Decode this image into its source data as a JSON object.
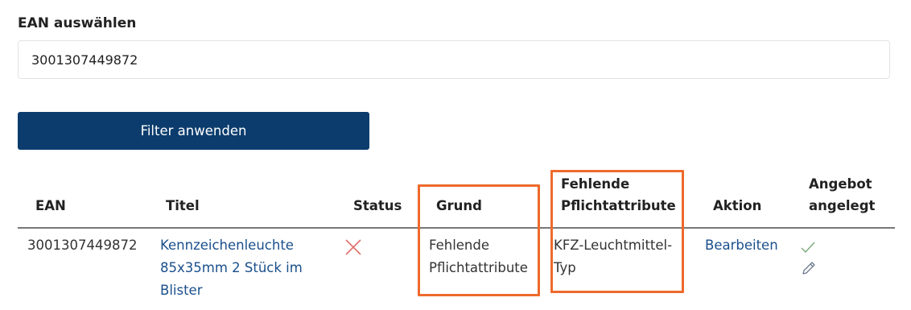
{
  "filter": {
    "label": "EAN auswählen",
    "ean_value": "3001307449872",
    "apply_button": "Filter anwenden"
  },
  "table": {
    "headers": {
      "ean": "EAN",
      "titel": "Titel",
      "status": "Status",
      "grund": "Grund",
      "pflicht_line1": "Fehlende",
      "pflicht_line2": "Pflichtattribute",
      "aktion": "Aktion",
      "angebot_line1": "Angebot",
      "angebot_line2": "angelegt"
    },
    "rows": [
      {
        "ean": "3001307449872",
        "titel_line1": "Kennzeichenleuchte",
        "titel_line2": "85x35mm 2 Stück im",
        "titel_line3": "Blister",
        "status_icon": "x-mark-icon",
        "grund_line1": "Fehlende",
        "grund_line2": "Pflichtattribute",
        "pflicht_line1": "KFZ-Leuchtmittel-",
        "pflicht_line2": "Typ",
        "aktion": "Bearbeiten",
        "angebot_icons": [
          "check-icon",
          "pencil-icon"
        ]
      }
    ]
  },
  "colors": {
    "button_bg": "#0b3c6d",
    "highlight": "#ee6a2c",
    "status_x": "#e0706b",
    "link": "#1a4f8b",
    "icon_gray": "#6c7a8c"
  }
}
